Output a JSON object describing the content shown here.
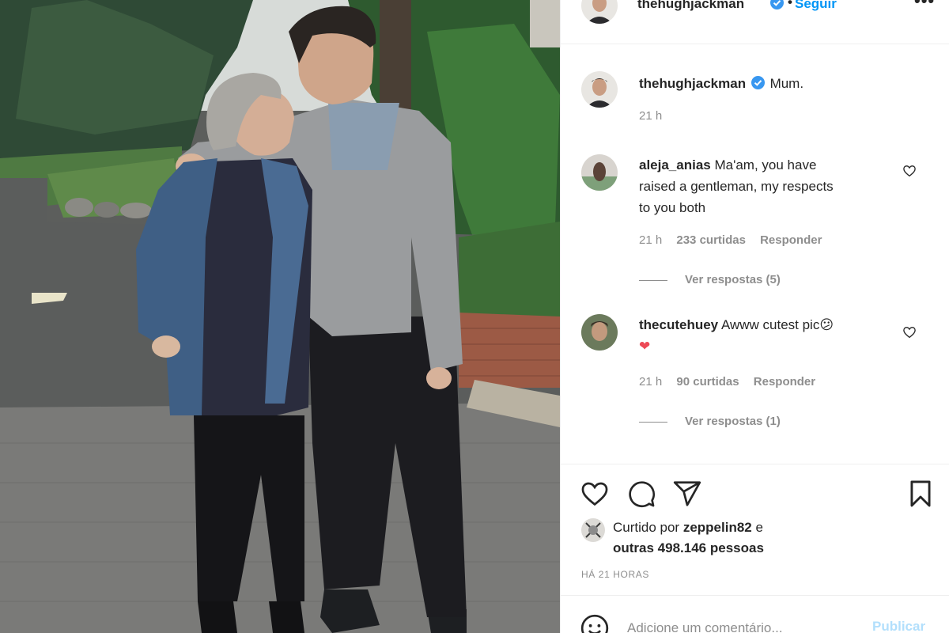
{
  "post": {
    "author": "thehughjackman",
    "follow_label": "Seguir",
    "header_separator": "•",
    "more_label": "•••",
    "caption": "Mum.",
    "caption_time": "21 h"
  },
  "comments": [
    {
      "username": "aleja_anias",
      "text_lines": [
        "Ma'am, you have",
        "raised a gentleman, my respects",
        "to you both"
      ],
      "time": "21 h",
      "likes": "233 curtidas",
      "reply_label": "Responder",
      "view_replies": "Ver respostas (5)"
    },
    {
      "username": "thecutehuey",
      "text": "Awww cutest pic",
      "emoji": "😕",
      "heart_emoji": "❤",
      "time": "21 h",
      "likes": "90 curtidas",
      "reply_label": "Responder",
      "view_replies": "Ver respostas (1)"
    }
  ],
  "actions": {
    "like_icon": "heart-icon",
    "comment_icon": "comment-icon",
    "share_icon": "paper-plane-icon",
    "save_icon": "bookmark-icon"
  },
  "likes": {
    "prefix": "Curtido por ",
    "liker": "zeppelin82",
    "connector": " e",
    "others": "outras 498.146 pessoas"
  },
  "timestamp": "HÁ 21 HORAS",
  "comment_bar": {
    "placeholder": "Adicione um comentário...",
    "publish_label": "Publicar",
    "emoji_icon": "smiley-icon"
  },
  "colors": {
    "link_blue": "#0095f6",
    "publish_disabled": "#b2dffc",
    "verified_blue": "#3897f0",
    "text": "#262626",
    "muted": "#8e8e8e",
    "heart_red": "#ed4956"
  }
}
